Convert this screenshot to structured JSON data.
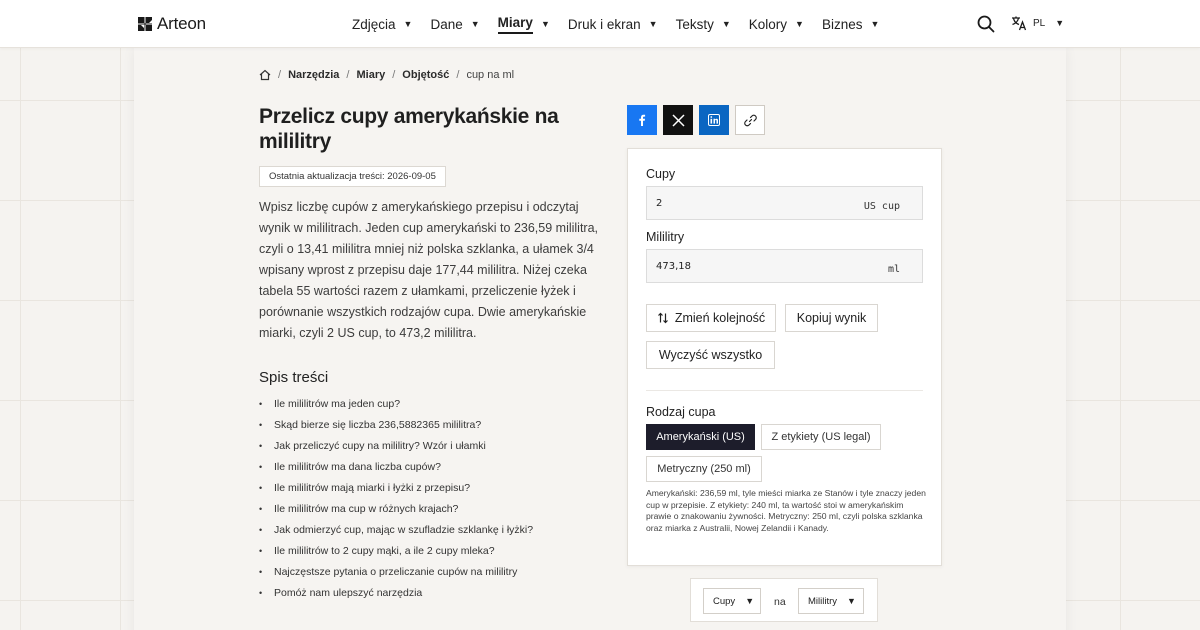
{
  "brand": {
    "name": "Arteon"
  },
  "nav": {
    "items": [
      {
        "label": "Zdjęcia",
        "active": false
      },
      {
        "label": "Dane",
        "active": false
      },
      {
        "label": "Miary",
        "active": true
      },
      {
        "label": "Druk i ekran",
        "active": false
      },
      {
        "label": "Teksty",
        "active": false
      },
      {
        "label": "Kolory",
        "active": false
      },
      {
        "label": "Biznes",
        "active": false
      }
    ],
    "lang": "PL"
  },
  "breadcrumb": {
    "items": [
      "Narzędzia",
      "Miary",
      "Objętość"
    ],
    "current": "cup na ml"
  },
  "page": {
    "title": "Przelicz cupy amerykańskie na mililitry",
    "updated": "Ostatnia aktualizacja treści: 2026-09-05",
    "intro": "Wpisz liczbę cupów z amerykańskiego przepisu i odczytaj wynik w mililitrach. Jeden cup amerykański to 236,59 mililitra, czyli o 13,41 mililitra mniej niż polska szklanka, a ułamek 3/4 wpisany wprost z przepisu daje 177,44 mililitra. Niżej czeka tabela 55 wartości razem z ułamkami, przeliczenie łyżek i porównanie wszystkich rodzajów cupa. Dwie amerykańskie miarki, czyli 2 US cup, to 473,2 mililitra."
  },
  "toc": {
    "title": "Spis treści",
    "items": [
      "Ile mililitrów ma jeden cup?",
      "Skąd bierze się liczba 236,5882365 mililitra?",
      "Jak przeliczyć cupy na mililitry? Wzór i ułamki",
      "Ile mililitrów ma dana liczba cupów?",
      "Ile mililitrów mają miarki i łyżki z przepisu?",
      "Ile mililitrów ma cup w różnych krajach?",
      "Jak odmierzyć cup, mając w szufladzie szklankę i łyżki?",
      "Ile mililitrów to 2 cupy mąki, a ile 2 cupy mleka?",
      "Najczęstsze pytania o przeliczanie cupów na mililitry",
      "Pomóż nam ulepszyć narzędzia"
    ]
  },
  "converter": {
    "from_label": "Cupy",
    "from_value": "2",
    "from_unit": "US cup",
    "to_label": "Mililitry",
    "to_value": "473,18",
    "to_unit": "ml",
    "swap_label": "Zmień kolejność",
    "copy_label": "Kopiuj wynik",
    "clear_label": "Wyczyść wszystko",
    "cup_type_label": "Rodzaj cupa",
    "cup_types": [
      {
        "label": "Amerykański (US)",
        "selected": true
      },
      {
        "label": "Z etykiety (US legal)",
        "selected": false
      },
      {
        "label": "Metryczny (250 ml)",
        "selected": false
      }
    ],
    "note": "Amerykański: 236,59 ml, tyle mieści miarka ze Stanów i tyle znaczy jeden cup w przepisie. Z etykiety: 240 ml, ta wartość stoi w amerykańskim prawie o znakowaniu żywności. Metryczny: 250 ml, czyli polska szklanka oraz miarka z Australii, Nowej Zelandii i Kanady."
  },
  "switcher": {
    "from": "Cupy",
    "connector": "na",
    "to": "Mililitry"
  },
  "colors": {
    "facebook": "#1877f2",
    "x": "#111111",
    "linkedin": "#0a66c2",
    "selected_option": "#1d1d2b"
  }
}
